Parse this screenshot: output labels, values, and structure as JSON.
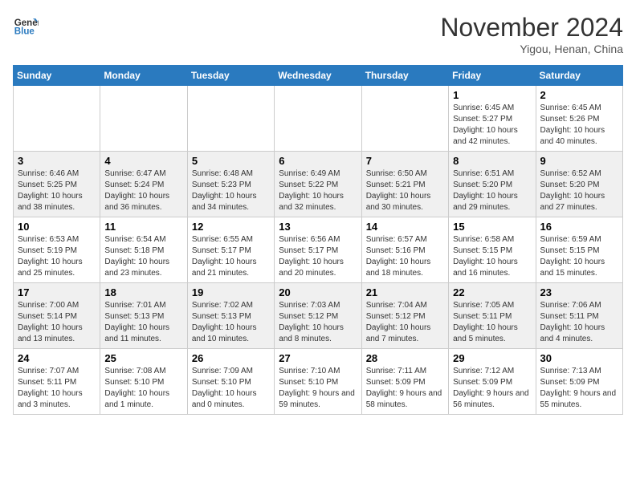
{
  "header": {
    "logo_line1": "General",
    "logo_line2": "Blue",
    "month": "November 2024",
    "location": "Yigou, Henan, China"
  },
  "weekdays": [
    "Sunday",
    "Monday",
    "Tuesday",
    "Wednesday",
    "Thursday",
    "Friday",
    "Saturday"
  ],
  "weeks": [
    [
      {
        "day": "",
        "info": ""
      },
      {
        "day": "",
        "info": ""
      },
      {
        "day": "",
        "info": ""
      },
      {
        "day": "",
        "info": ""
      },
      {
        "day": "",
        "info": ""
      },
      {
        "day": "1",
        "info": "Sunrise: 6:45 AM\nSunset: 5:27 PM\nDaylight: 10 hours and 42 minutes."
      },
      {
        "day": "2",
        "info": "Sunrise: 6:45 AM\nSunset: 5:26 PM\nDaylight: 10 hours and 40 minutes."
      }
    ],
    [
      {
        "day": "3",
        "info": "Sunrise: 6:46 AM\nSunset: 5:25 PM\nDaylight: 10 hours and 38 minutes."
      },
      {
        "day": "4",
        "info": "Sunrise: 6:47 AM\nSunset: 5:24 PM\nDaylight: 10 hours and 36 minutes."
      },
      {
        "day": "5",
        "info": "Sunrise: 6:48 AM\nSunset: 5:23 PM\nDaylight: 10 hours and 34 minutes."
      },
      {
        "day": "6",
        "info": "Sunrise: 6:49 AM\nSunset: 5:22 PM\nDaylight: 10 hours and 32 minutes."
      },
      {
        "day": "7",
        "info": "Sunrise: 6:50 AM\nSunset: 5:21 PM\nDaylight: 10 hours and 30 minutes."
      },
      {
        "day": "8",
        "info": "Sunrise: 6:51 AM\nSunset: 5:20 PM\nDaylight: 10 hours and 29 minutes."
      },
      {
        "day": "9",
        "info": "Sunrise: 6:52 AM\nSunset: 5:20 PM\nDaylight: 10 hours and 27 minutes."
      }
    ],
    [
      {
        "day": "10",
        "info": "Sunrise: 6:53 AM\nSunset: 5:19 PM\nDaylight: 10 hours and 25 minutes."
      },
      {
        "day": "11",
        "info": "Sunrise: 6:54 AM\nSunset: 5:18 PM\nDaylight: 10 hours and 23 minutes."
      },
      {
        "day": "12",
        "info": "Sunrise: 6:55 AM\nSunset: 5:17 PM\nDaylight: 10 hours and 21 minutes."
      },
      {
        "day": "13",
        "info": "Sunrise: 6:56 AM\nSunset: 5:17 PM\nDaylight: 10 hours and 20 minutes."
      },
      {
        "day": "14",
        "info": "Sunrise: 6:57 AM\nSunset: 5:16 PM\nDaylight: 10 hours and 18 minutes."
      },
      {
        "day": "15",
        "info": "Sunrise: 6:58 AM\nSunset: 5:15 PM\nDaylight: 10 hours and 16 minutes."
      },
      {
        "day": "16",
        "info": "Sunrise: 6:59 AM\nSunset: 5:15 PM\nDaylight: 10 hours and 15 minutes."
      }
    ],
    [
      {
        "day": "17",
        "info": "Sunrise: 7:00 AM\nSunset: 5:14 PM\nDaylight: 10 hours and 13 minutes."
      },
      {
        "day": "18",
        "info": "Sunrise: 7:01 AM\nSunset: 5:13 PM\nDaylight: 10 hours and 11 minutes."
      },
      {
        "day": "19",
        "info": "Sunrise: 7:02 AM\nSunset: 5:13 PM\nDaylight: 10 hours and 10 minutes."
      },
      {
        "day": "20",
        "info": "Sunrise: 7:03 AM\nSunset: 5:12 PM\nDaylight: 10 hours and 8 minutes."
      },
      {
        "day": "21",
        "info": "Sunrise: 7:04 AM\nSunset: 5:12 PM\nDaylight: 10 hours and 7 minutes."
      },
      {
        "day": "22",
        "info": "Sunrise: 7:05 AM\nSunset: 5:11 PM\nDaylight: 10 hours and 5 minutes."
      },
      {
        "day": "23",
        "info": "Sunrise: 7:06 AM\nSunset: 5:11 PM\nDaylight: 10 hours and 4 minutes."
      }
    ],
    [
      {
        "day": "24",
        "info": "Sunrise: 7:07 AM\nSunset: 5:11 PM\nDaylight: 10 hours and 3 minutes."
      },
      {
        "day": "25",
        "info": "Sunrise: 7:08 AM\nSunset: 5:10 PM\nDaylight: 10 hours and 1 minute."
      },
      {
        "day": "26",
        "info": "Sunrise: 7:09 AM\nSunset: 5:10 PM\nDaylight: 10 hours and 0 minutes."
      },
      {
        "day": "27",
        "info": "Sunrise: 7:10 AM\nSunset: 5:10 PM\nDaylight: 9 hours and 59 minutes."
      },
      {
        "day": "28",
        "info": "Sunrise: 7:11 AM\nSunset: 5:09 PM\nDaylight: 9 hours and 58 minutes."
      },
      {
        "day": "29",
        "info": "Sunrise: 7:12 AM\nSunset: 5:09 PM\nDaylight: 9 hours and 56 minutes."
      },
      {
        "day": "30",
        "info": "Sunrise: 7:13 AM\nSunset: 5:09 PM\nDaylight: 9 hours and 55 minutes."
      }
    ]
  ]
}
